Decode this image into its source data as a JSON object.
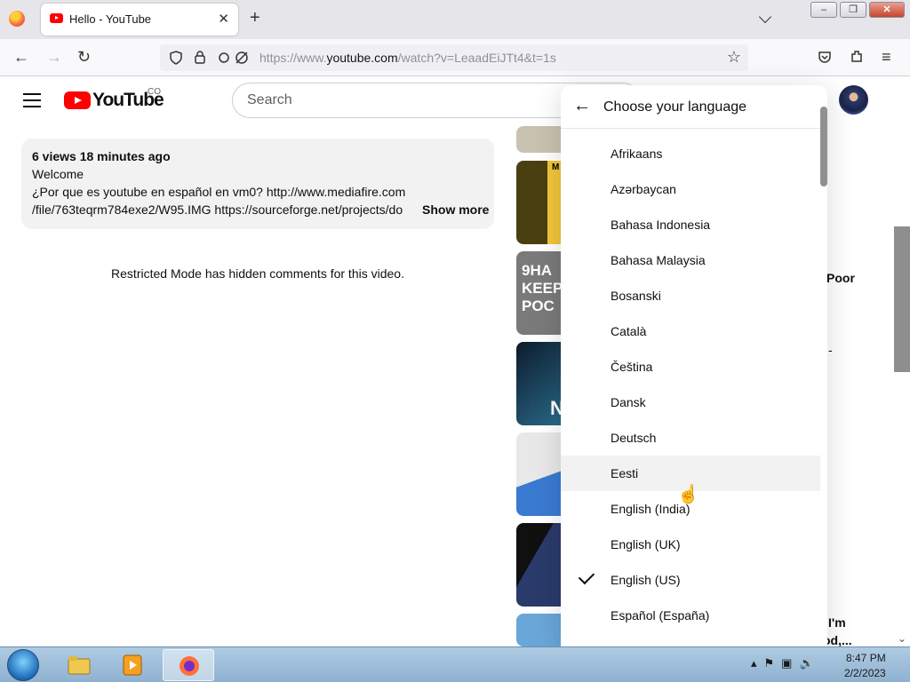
{
  "browser": {
    "tab_title": "Hello - YouTube",
    "tab_close": "✕",
    "new_tab": "+",
    "url_prefix": "https://www.",
    "url_host": "youtube.com",
    "url_path": "/watch?v=LeaadEiJTt4&t=1s"
  },
  "youtube": {
    "wordmark": "YouTube",
    "country": "CO",
    "search_placeholder": "Search"
  },
  "description": {
    "meta": "6 views  18 minutes ago",
    "line1": "Welcome",
    "line2": "¿Por que es youtube en español en vm0? http://www.mediafire.com",
    "line3": "/file/763teqrm784exe2/W95.IMG https://sourceforge.net/projects/do",
    "show_more": "Show more"
  },
  "comments_notice": "Restricted Mode has hidden comments for this video.",
  "thumbnails": {
    "t2_text": "M",
    "t3_text": "9HA KEEPIN POC",
    "t4_text": "N"
  },
  "peek_text": {
    "poor": "Poor",
    "dash": "-",
    "im": "I'm",
    "od": "od,..."
  },
  "language_menu": {
    "title": "Choose your language",
    "selected": "English (US)",
    "hovered": "Eesti",
    "items": [
      "Afrikaans",
      "Azərbaycan",
      "Bahasa Indonesia",
      "Bahasa Malaysia",
      "Bosanski",
      "Català",
      "Čeština",
      "Dansk",
      "Deutsch",
      "Eesti",
      "English (India)",
      "English (UK)",
      "English (US)",
      "Español (España)"
    ]
  },
  "taskbar": {
    "time": "8:47 PM",
    "date": "2/2/2023"
  },
  "colors": {
    "youtube_red": "#ff0000",
    "taskbar": "#9dbcd9"
  }
}
